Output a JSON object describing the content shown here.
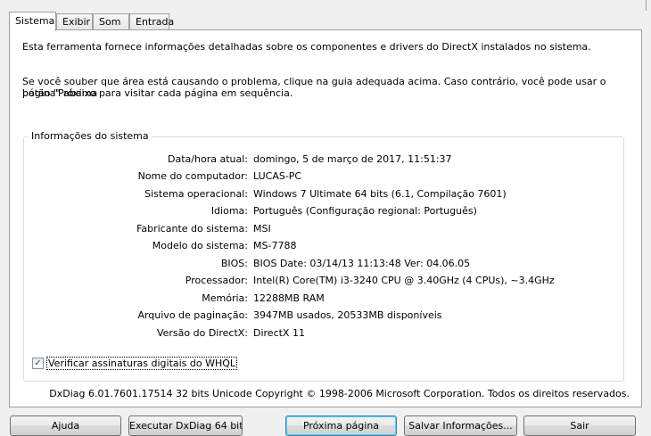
{
  "tabs": [
    {
      "label": "Sistema",
      "active": true
    },
    {
      "label": "Exibir",
      "active": false
    },
    {
      "label": "Som",
      "active": false
    },
    {
      "label": "Entrada",
      "active": false
    }
  ],
  "intro": {
    "line1": "Esta ferramenta fornece informações detalhadas sobre os componentes e drivers do DirectX instalados no sistema.",
    "line2a": "Se você souber que área está causando o problema, clique na guia adequada acima. Caso contrário, você pode usar o botão \"Próxima",
    "line2b": "página\" abaixo para visitar cada página em sequência."
  },
  "system_info": {
    "title": "Informações do sistema",
    "rows": [
      {
        "label": "Data/hora atual:",
        "value": "domingo, 5 de março de 2017, 11:51:37"
      },
      {
        "label": "Nome do computador:",
        "value": "LUCAS-PC"
      },
      {
        "label": "Sistema operacional:",
        "value": "Windows 7 Ultimate 64 bits (6.1, Compilação 7601)"
      },
      {
        "label": "Idioma:",
        "value": "Português (Configuração regional: Português)"
      },
      {
        "label": "Fabricante do sistema:",
        "value": "MSI"
      },
      {
        "label": "Modelo do sistema:",
        "value": "MS-7788"
      },
      {
        "label": "BIOS:",
        "value": "BIOS Date: 03/14/13 11:13:48 Ver: 04.06.05"
      },
      {
        "label": "Processador:",
        "value": "Intel(R) Core(TM) i3-3240 CPU @ 3.40GHz (4 CPUs), ~3.4GHz"
      },
      {
        "label": "Memória:",
        "value": "12288MB RAM"
      },
      {
        "label": "Arquivo de paginação:",
        "value": "3947MB usados, 20533MB disponíveis"
      },
      {
        "label": "Versão do DirectX:",
        "value": "DirectX 11"
      }
    ]
  },
  "whql": {
    "label": "Verificar assinaturas digitais do WHQL",
    "checked": true,
    "check_glyph": "✓"
  },
  "copyright": "DxDiag 6.01.7601.17514 32 bits Unicode  Copyright © 1998-2006 Microsoft Corporation.  Todos os direitos reservados.",
  "buttons": {
    "help": "Ajuda",
    "run64": "Executar DxDiag 64 bits",
    "next": "Próxima página",
    "save": "Salvar Informações...",
    "exit": "Sair"
  }
}
